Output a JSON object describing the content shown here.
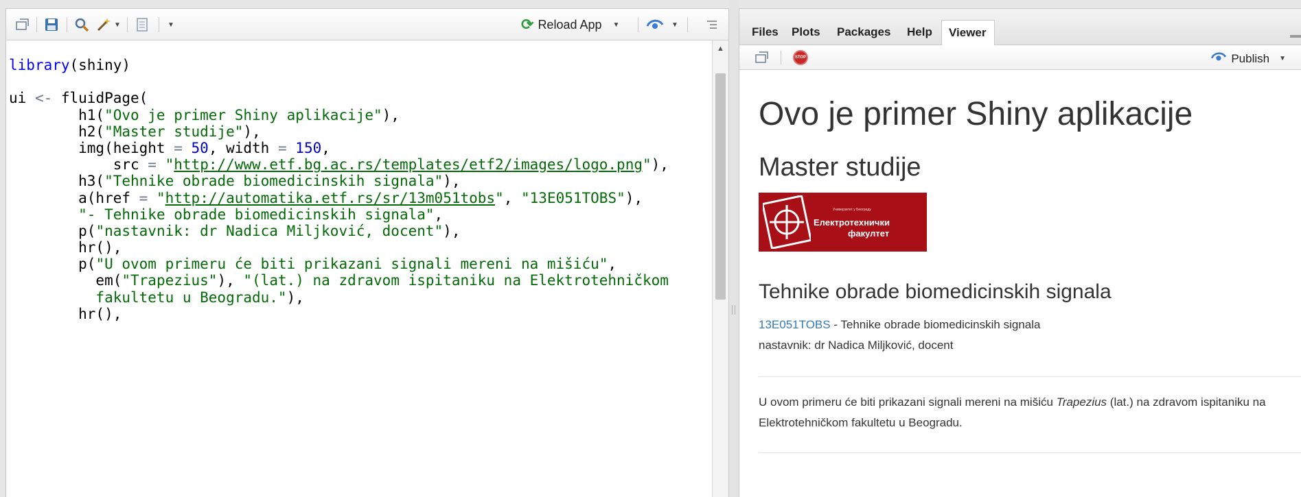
{
  "editor": {
    "toolbar": {
      "reload_label": "Reload App"
    },
    "code_lines": [
      [
        {
          "t": "library",
          "c": "fn"
        },
        {
          "t": "(shiny)",
          "c": ""
        }
      ],
      [],
      [
        {
          "t": "ui ",
          "c": ""
        },
        {
          "t": "<-",
          "c": "op"
        },
        {
          "t": " fluidPage(",
          "c": ""
        }
      ],
      [
        {
          "t": "        h1(",
          "c": ""
        },
        {
          "t": "\"Ovo je primer Shiny aplikacije\"",
          "c": "str"
        },
        {
          "t": "),",
          "c": ""
        }
      ],
      [
        {
          "t": "        h2(",
          "c": ""
        },
        {
          "t": "\"Master studije\"",
          "c": "str"
        },
        {
          "t": "),",
          "c": ""
        }
      ],
      [
        {
          "t": "        img(height ",
          "c": ""
        },
        {
          "t": "=",
          "c": "op"
        },
        {
          "t": " ",
          "c": ""
        },
        {
          "t": "50",
          "c": "num"
        },
        {
          "t": ", width ",
          "c": ""
        },
        {
          "t": "=",
          "c": "op"
        },
        {
          "t": " ",
          "c": ""
        },
        {
          "t": "150",
          "c": "num"
        },
        {
          "t": ",",
          "c": ""
        }
      ],
      [
        {
          "t": "            src ",
          "c": ""
        },
        {
          "t": "=",
          "c": "op"
        },
        {
          "t": " ",
          "c": ""
        },
        {
          "t": "\"",
          "c": "str"
        },
        {
          "t": "http://www.etf.bg.ac.rs/templates/etf2/images/logo.png",
          "c": "url"
        },
        {
          "t": "\"",
          "c": "str"
        },
        {
          "t": "),",
          "c": ""
        }
      ],
      [
        {
          "t": "        h3(",
          "c": ""
        },
        {
          "t": "\"Tehnike obrade biomedicinskih signala\"",
          "c": "str"
        },
        {
          "t": "),",
          "c": ""
        }
      ],
      [
        {
          "t": "        a(href ",
          "c": ""
        },
        {
          "t": "=",
          "c": "op"
        },
        {
          "t": " ",
          "c": ""
        },
        {
          "t": "\"",
          "c": "str"
        },
        {
          "t": "http://automatika.etf.rs/sr/13m051tobs",
          "c": "url"
        },
        {
          "t": "\"",
          "c": "str"
        },
        {
          "t": ", ",
          "c": ""
        },
        {
          "t": "\"13E051TOBS\"",
          "c": "str"
        },
        {
          "t": "),",
          "c": ""
        }
      ],
      [
        {
          "t": "        ",
          "c": ""
        },
        {
          "t": "\"- Tehnike obrade biomedicinskih signala\"",
          "c": "str"
        },
        {
          "t": ",",
          "c": ""
        }
      ],
      [
        {
          "t": "        p(",
          "c": ""
        },
        {
          "t": "\"nastavnik: dr Nadica Miljković, docent\"",
          "c": "str"
        },
        {
          "t": "),",
          "c": ""
        }
      ],
      [
        {
          "t": "        hr(),",
          "c": ""
        }
      ],
      [
        {
          "t": "        p(",
          "c": ""
        },
        {
          "t": "\"U ovom primeru će biti prikazani signali mereni na mišiću\"",
          "c": "str"
        },
        {
          "t": ",",
          "c": ""
        }
      ],
      [
        {
          "t": "          em(",
          "c": ""
        },
        {
          "t": "\"Trapezius\"",
          "c": "str"
        },
        {
          "t": "), ",
          "c": ""
        },
        {
          "t": "\"(lat.) na zdravom ispitaniku na Elektrotehničkom",
          "c": "str"
        }
      ],
      [
        {
          "t": "          fakultetu u Beogradu.\"",
          "c": "str"
        },
        {
          "t": "),",
          "c": ""
        }
      ],
      [
        {
          "t": "        hr(),",
          "c": ""
        }
      ]
    ]
  },
  "viewer": {
    "tabs": [
      {
        "label": "Files",
        "active": false
      },
      {
        "label": "Plots",
        "active": false
      },
      {
        "label": "Packages",
        "active": false
      },
      {
        "label": "Help",
        "active": false
      },
      {
        "label": "Viewer",
        "active": true
      }
    ],
    "stop_label": "STOP",
    "publish_label": "Publish",
    "page": {
      "h1": "Ovo je primer Shiny aplikacije",
      "h2": "Master studije",
      "logo": {
        "small_text": "Универзитет у Београду",
        "line1": "Електротехнички",
        "line2": "факултет"
      },
      "h3": "Tehnike obrade biomedicinskih signala",
      "link_text": "13E051TOBS",
      "link_suffix": " - Tehnike obrade biomedicinskih signala",
      "teacher": "nastavnik: dr Nadica Miljković, docent",
      "para_before": "U ovom primeru će biti prikazani signali mereni na mišiću ",
      "para_em": "Trapezius",
      "para_after": " (lat.) na zdravom ispitaniku na Elektrotehničkom fakultetu u Beogradu."
    }
  },
  "colors": {
    "string": "#036a07",
    "keyword": "#0000ff",
    "number": "#0000cd",
    "link": "#337ab7",
    "logo_bg": "#a80f16",
    "reload_icon": "#2e9e3c",
    "stop_icon": "#c62828"
  }
}
